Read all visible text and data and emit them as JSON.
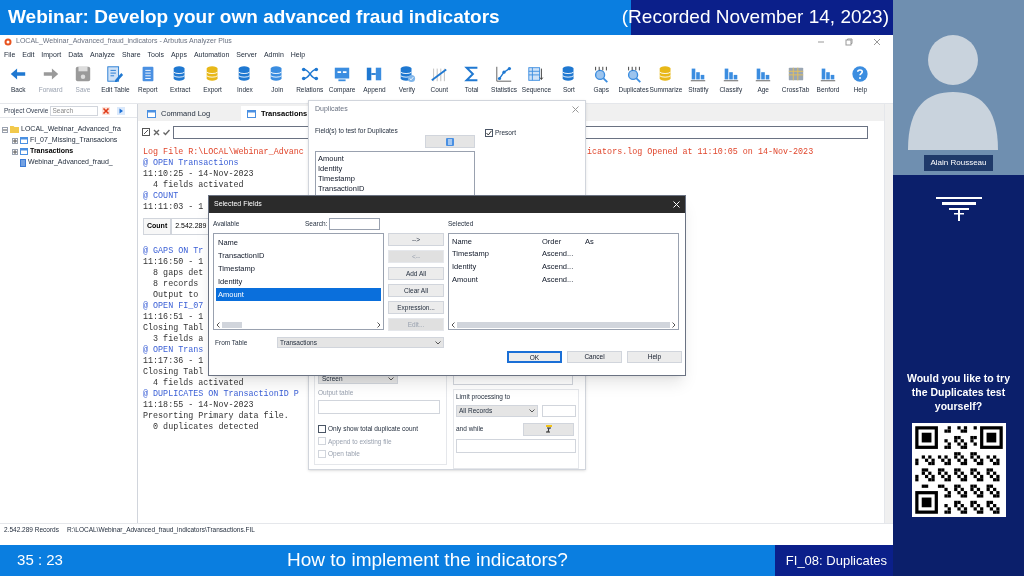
{
  "webinar_title": "Webinar: Develop your own advanced fraud indicators",
  "recorded": "(Recorded November 14, 2023)",
  "app": {
    "title": "LOCAL_Webinar_Advanced_fraud_indicators - Arbutus Analyzer Plus",
    "menu": [
      "File",
      "Edit",
      "Import",
      "Data",
      "Analyze",
      "Share",
      "Tools",
      "Apps",
      "Automation",
      "Server",
      "Admin",
      "Help"
    ],
    "toolbar": [
      {
        "label": "Back",
        "disabled": false
      },
      {
        "label": "Forward",
        "disabled": true
      },
      {
        "label": "Save",
        "disabled": true
      },
      {
        "label": "Edit Table",
        "disabled": false
      },
      {
        "label": "Report",
        "disabled": false
      },
      {
        "label": "Extract",
        "disabled": false
      },
      {
        "label": "Export",
        "disabled": false
      },
      {
        "label": "Index",
        "disabled": false
      },
      {
        "label": "Join",
        "disabled": false
      },
      {
        "label": "Relations",
        "disabled": false
      },
      {
        "label": "Compare",
        "disabled": false
      },
      {
        "label": "Append",
        "disabled": false
      },
      {
        "label": "Verify",
        "disabled": false
      },
      {
        "label": "Count",
        "disabled": false
      },
      {
        "label": "Total",
        "disabled": false
      },
      {
        "label": "Statistics",
        "disabled": false
      },
      {
        "label": "Sequence",
        "disabled": false
      },
      {
        "label": "Sort",
        "disabled": false
      },
      {
        "label": "Gaps",
        "disabled": false
      },
      {
        "label": "Duplicates",
        "disabled": false
      },
      {
        "label": "Summarize",
        "disabled": false
      },
      {
        "label": "Stratify",
        "disabled": false
      },
      {
        "label": "Classify",
        "disabled": false
      },
      {
        "label": "Age",
        "disabled": false
      },
      {
        "label": "CrossTab",
        "disabled": false
      },
      {
        "label": "Benford",
        "disabled": false
      },
      {
        "label": "Help",
        "disabled": false
      }
    ],
    "project": {
      "label": "Project Overvie",
      "search_placeholder": "Search",
      "tree": [
        {
          "label": "LOCAL_Webinar_Advanced_fra",
          "kind": "folder",
          "expanded": true,
          "selected": false,
          "children": [
            {
              "label": "FI_07_Missing_Transacions",
              "kind": "table",
              "expanded": false,
              "selected": false
            },
            {
              "label": "Transactions",
              "kind": "table",
              "expanded": false,
              "selected": true
            },
            {
              "label": "Webinar_Advanced_fraud_",
              "kind": "log",
              "selected": false
            }
          ]
        }
      ]
    },
    "tabs": [
      {
        "label": "Command Log",
        "selected": false
      },
      {
        "label": "Transactions",
        "selected": true
      }
    ],
    "log": [
      {
        "kind": "path",
        "text": "Log File R:\\LOCAL\\Webinar_Advanc",
        "text_2": "icators.log Opened at 11:10:05 on 14-Nov-2023"
      },
      {
        "kind": "command",
        "text": "@ OPEN Transactions"
      },
      {
        "kind": "output",
        "text": "11:10:25 - 14-Nov-2023"
      },
      {
        "kind": "output",
        "text": "  4 fields activated"
      },
      {
        "kind": "command",
        "text": "@ COUNT"
      },
      {
        "kind": "output",
        "text": "11:11:03 - 1"
      },
      {
        "kind": "count",
        "text": "Count",
        "value": "2.542.289"
      },
      {
        "kind": "command",
        "text": "@ GAPS ON Tr"
      },
      {
        "kind": "output",
        "text": "11:16:50 - 1"
      },
      {
        "kind": "output",
        "text": "  8 gaps det"
      },
      {
        "kind": "output",
        "text": "  8 records"
      },
      {
        "kind": "output",
        "text": "  Output to"
      },
      {
        "kind": "command",
        "text": "@ OPEN FI_07"
      },
      {
        "kind": "output",
        "text": "11:16:51 - 1"
      },
      {
        "kind": "output",
        "text": "Closing Tabl"
      },
      {
        "kind": "output",
        "text": "  3 fields a"
      },
      {
        "kind": "command",
        "text": "@ OPEN Trans"
      },
      {
        "kind": "output",
        "text": "11:17:36 - 1"
      },
      {
        "kind": "output",
        "text": "Closing Tabl"
      },
      {
        "kind": "output",
        "text": "  4 fields activated"
      },
      {
        "kind": "command",
        "text": "@ DUPLICATES ON TransactionID P"
      },
      {
        "kind": "output",
        "text": "11:18:55 - 14-Nov-2023"
      },
      {
        "kind": "output",
        "text": "Presorting Primary data file."
      },
      {
        "kind": "output",
        "text": "  0 duplicates detected"
      }
    ],
    "status_bar": {
      "records": "2.542.289 Records",
      "path": "R:\\LOCAL\\Webinar_Advanced_fraud_indicators\\Transactions.FIL"
    }
  },
  "duplicates_dialog": {
    "title": "Duplicates",
    "fields_label": "Field(s) to test for Duplicates",
    "fields": [
      "Amount",
      "Identity",
      "Timestamp",
      "TransactionID"
    ],
    "presort": {
      "label": "Presort",
      "checked": true
    },
    "output_select": "Screen",
    "output_table_label": "Output table",
    "options": [
      {
        "label": "Only show total duplicate count",
        "checked": false,
        "disabled": false
      },
      {
        "label": "Append to existing file",
        "checked": false,
        "disabled": true
      },
      {
        "label": "Open table",
        "checked": false,
        "disabled": true
      }
    ],
    "limit_label": "Limit processing to",
    "limit_select": "All Records",
    "while_label": "and while"
  },
  "selected_fields_dialog": {
    "title": "Selected Fields",
    "available_label": "Available",
    "search_label": "Search:",
    "available": [
      {
        "label": "Name",
        "selected": false
      },
      {
        "label": "TransactionID",
        "selected": false
      },
      {
        "label": "Timestamp",
        "selected": false
      },
      {
        "label": "Identity",
        "selected": false
      },
      {
        "label": "Amount",
        "selected": true
      }
    ],
    "buttons": [
      {
        "label": "-->",
        "disabled": false
      },
      {
        "label": "<--",
        "disabled": true
      },
      {
        "label": "Add All",
        "disabled": false
      },
      {
        "label": "Clear All",
        "disabled": false
      },
      {
        "label": "Expression...",
        "disabled": false
      },
      {
        "label": "Edit...",
        "disabled": true
      }
    ],
    "selected_label": "Selected",
    "columns": [
      "Name",
      "Order",
      "As"
    ],
    "rows": [
      {
        "name": "Timestamp",
        "order": "Ascend..."
      },
      {
        "name": "Identity",
        "order": "Ascend..."
      },
      {
        "name": "Amount",
        "order": "Ascend..."
      }
    ],
    "from_table_label": "From Table",
    "from_table": "Transactions",
    "actions": [
      {
        "label": "OK",
        "selected": true
      },
      {
        "label": "Cancel",
        "selected": false
      },
      {
        "label": "Help",
        "selected": false
      }
    ]
  },
  "presenter": "Alain Rousseau",
  "promo": "Would you like to try the Duplicates test yourself?",
  "footer": {
    "time": "35 : 23",
    "topic": "How to implement the indicators?",
    "chapter": "FI_08: Duplicates"
  }
}
